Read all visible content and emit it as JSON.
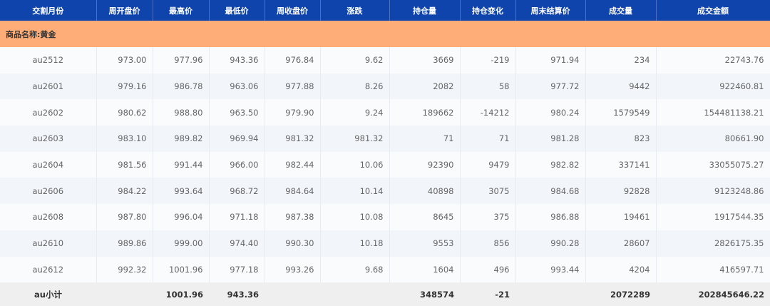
{
  "headers": [
    "交割月份",
    "周开盘价",
    "最高价",
    "最低价",
    "周收盘价",
    "涨跌",
    "持仓量",
    "持仓变化",
    "周末结算价",
    "成交量",
    "成交金额"
  ],
  "group_label": "商品名称:黄金",
  "rows": [
    [
      "au2512",
      "973.00",
      "977.96",
      "943.36",
      "976.84",
      "9.62",
      "3669",
      "-219",
      "971.94",
      "234",
      "22743.76"
    ],
    [
      "au2601",
      "979.16",
      "986.78",
      "963.06",
      "977.88",
      "8.26",
      "2082",
      "58",
      "977.72",
      "9442",
      "922460.81"
    ],
    [
      "au2602",
      "980.62",
      "988.80",
      "963.50",
      "979.90",
      "9.24",
      "189662",
      "-14212",
      "980.24",
      "1579549",
      "154481138.21"
    ],
    [
      "au2603",
      "983.10",
      "989.82",
      "969.94",
      "981.32",
      "981.32",
      "71",
      "71",
      "981.28",
      "823",
      "80661.90"
    ],
    [
      "au2604",
      "981.56",
      "991.44",
      "966.00",
      "982.44",
      "10.06",
      "92390",
      "9479",
      "982.82",
      "337141",
      "33055075.27"
    ],
    [
      "au2606",
      "984.22",
      "993.64",
      "968.72",
      "984.64",
      "10.14",
      "40898",
      "3075",
      "984.68",
      "92828",
      "9123248.86"
    ],
    [
      "au2608",
      "987.80",
      "996.04",
      "971.18",
      "987.38",
      "10.08",
      "8645",
      "375",
      "986.88",
      "19461",
      "1917544.35"
    ],
    [
      "au2610",
      "989.86",
      "999.00",
      "974.40",
      "990.30",
      "10.18",
      "9553",
      "856",
      "990.28",
      "28607",
      "2826175.35"
    ],
    [
      "au2612",
      "992.32",
      "1001.96",
      "977.18",
      "993.26",
      "9.68",
      "1604",
      "496",
      "993.44",
      "4204",
      "416597.71"
    ]
  ],
  "total": [
    "au小计",
    "",
    "1001.96",
    "943.36",
    "",
    "",
    "348574",
    "-21",
    "",
    "2072289",
    "202845646.22"
  ]
}
